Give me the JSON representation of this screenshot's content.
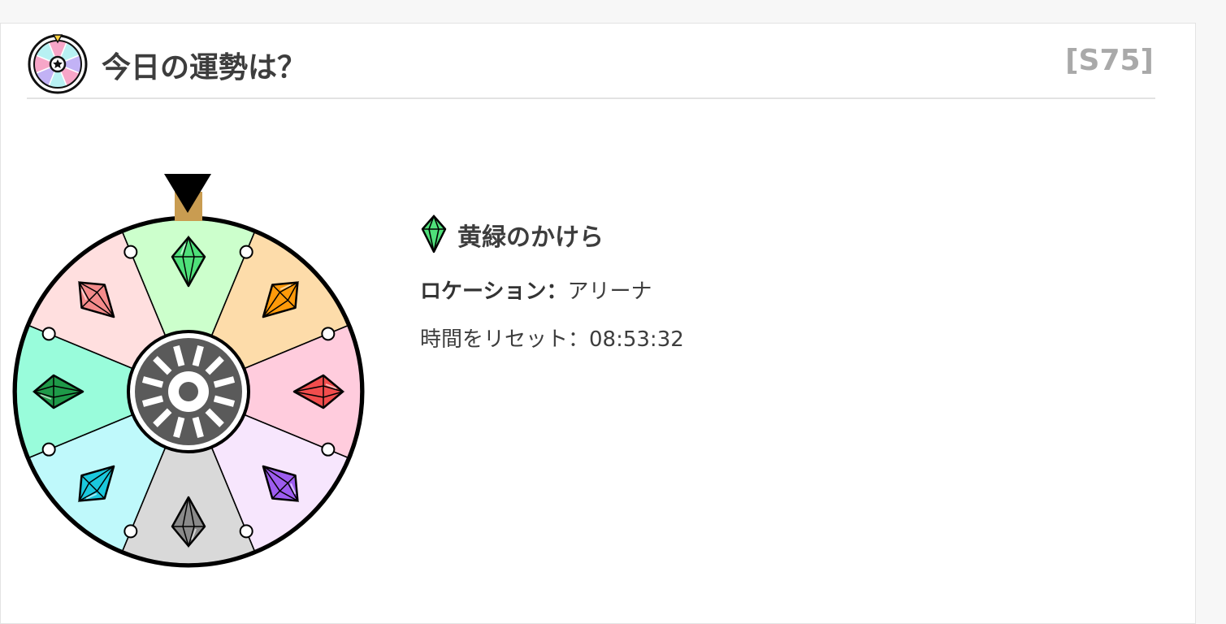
{
  "header": {
    "title": "今日の運勢は？",
    "season": "[S75]",
    "icon": "roulette-wheel-icon"
  },
  "wheel": {
    "pointer_icon": "pointer-triangle-icon",
    "segments": [
      {
        "name": "green-shard",
        "color": "#ccffcc",
        "gem_color": "#4fe07a",
        "icon": "green-gem-icon"
      },
      {
        "name": "orange-shard",
        "color": "#fddcaa",
        "gem_color": "#ff9a0a",
        "icon": "orange-gem-icon"
      },
      {
        "name": "red-shard",
        "color": "#ffccdd",
        "gem_color": "#f14d4d",
        "icon": "red-gem-icon"
      },
      {
        "name": "purple-shard",
        "color": "#f7e6fd",
        "gem_color": "#9d5cf0",
        "icon": "purple-gem-icon"
      },
      {
        "name": "gray-shard",
        "color": "#d9d9d9",
        "gem_color": "#8a8a8a",
        "icon": "gray-gem-icon"
      },
      {
        "name": "cyan-shard",
        "color": "#bff9fb",
        "gem_color": "#1bc8dd",
        "icon": "cyan-gem-icon"
      },
      {
        "name": "teal-shard",
        "color": "#99fcdb",
        "gem_color": "#1f9a49",
        "icon": "dark-green-gem-icon"
      },
      {
        "name": "pink-shard",
        "color": "#ffdfdf",
        "gem_color": "#f48b8b",
        "icon": "pink-gem-icon"
      }
    ],
    "hub_icon": "wheel-hub-icon"
  },
  "result": {
    "name": "黄緑のかけら",
    "gem_icon": "green-gem-icon",
    "location_label": "ロケーション：",
    "location_value": "アリーナ",
    "reset_text": "時間をリセット：08:53:32"
  }
}
